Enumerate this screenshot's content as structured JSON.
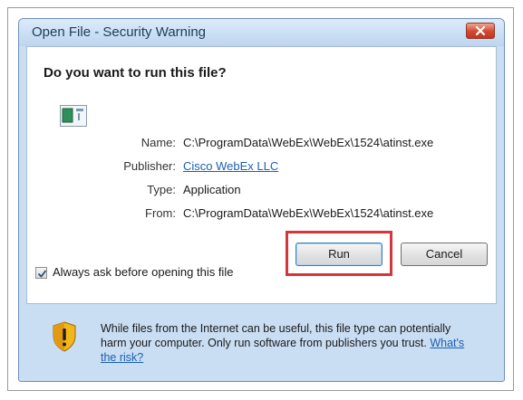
{
  "dialog": {
    "title": "Open File - Security Warning",
    "question": "Do you want to run this file?",
    "details": {
      "name_label": "Name:",
      "name_value": "C:\\ProgramData\\WebEx\\WebEx\\1524\\atinst.exe",
      "publisher_label": "Publisher:",
      "publisher_value": "Cisco WebEx LLC",
      "type_label": "Type:",
      "type_value": "Application",
      "from_label": "From:",
      "from_value": "C:\\ProgramData\\WebEx\\WebEx\\1524\\atinst.exe"
    },
    "buttons": {
      "run": "Run",
      "cancel": "Cancel"
    },
    "checkbox": {
      "label": "Always ask before opening this file",
      "checked": true
    },
    "warning": {
      "text": "While files from the Internet can be useful, this file type can potentially harm your computer. Only run software from publishers you trust.",
      "link": "What's the risk?"
    }
  },
  "colors": {
    "highlight": "#d4363c",
    "link": "#1a5fb4",
    "frame": "#c9def3"
  }
}
